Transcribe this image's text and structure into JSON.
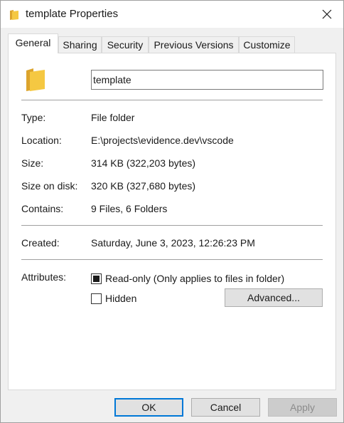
{
  "window": {
    "title": "template Properties",
    "icon": "folder-icon",
    "close_icon": "close-icon"
  },
  "tabs": [
    {
      "label": "General",
      "active": true
    },
    {
      "label": "Sharing",
      "active": false
    },
    {
      "label": "Security",
      "active": false
    },
    {
      "label": "Previous Versions",
      "active": false
    },
    {
      "label": "Customize",
      "active": false
    }
  ],
  "general": {
    "name_value": "template",
    "type_label": "Type:",
    "type_value": "File folder",
    "location_label": "Location:",
    "location_value": "E:\\projects\\evidence.dev\\vscode",
    "size_label": "Size:",
    "size_value": "314 KB (322,203 bytes)",
    "size_on_disk_label": "Size on disk:",
    "size_on_disk_value": "320 KB (327,680 bytes)",
    "contains_label": "Contains:",
    "contains_value": "9 Files, 6 Folders",
    "created_label": "Created:",
    "created_value": "Saturday, June 3, 2023, 12:26:23 PM",
    "attributes_label": "Attributes:",
    "readonly_label": "Read-only (Only applies to files in folder)",
    "readonly_state": "indeterminate",
    "hidden_label": "Hidden",
    "hidden_checked": false,
    "advanced_label": "Advanced..."
  },
  "footer": {
    "ok_label": "OK",
    "cancel_label": "Cancel",
    "apply_label": "Apply",
    "apply_enabled": false
  },
  "colors": {
    "accent": "#0078d7",
    "folder_yellow": "#f5c842",
    "folder_dark": "#dca42c"
  }
}
